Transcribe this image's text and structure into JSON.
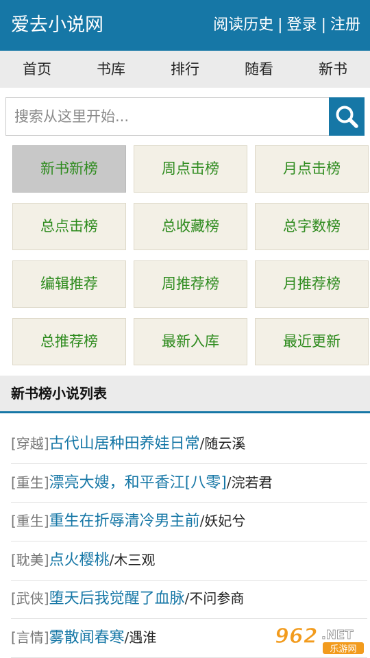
{
  "header": {
    "title": "爱去小说网",
    "links": [
      "阅读历史",
      "登录",
      "注册"
    ],
    "separator": "|"
  },
  "nav": {
    "items": [
      "首页",
      "书库",
      "排行",
      "随看",
      "新书"
    ]
  },
  "search": {
    "placeholder": "搜索从这里开始...",
    "icon": "search-icon"
  },
  "rankings": {
    "items": [
      {
        "label": "新书新榜",
        "active": true
      },
      {
        "label": "周点击榜",
        "active": false
      },
      {
        "label": "月点击榜",
        "active": false
      },
      {
        "label": "总点击榜",
        "active": false
      },
      {
        "label": "总收藏榜",
        "active": false
      },
      {
        "label": "总字数榜",
        "active": false
      },
      {
        "label": "编辑推荐",
        "active": false
      },
      {
        "label": "周推荐榜",
        "active": false
      },
      {
        "label": "月推荐榜",
        "active": false
      },
      {
        "label": "总推荐榜",
        "active": false
      },
      {
        "label": "最新入库",
        "active": false
      },
      {
        "label": "最近更新",
        "active": false
      }
    ]
  },
  "list": {
    "title": "新书榜小说列表",
    "slash": "/",
    "books": [
      {
        "genre": "[穿越]",
        "title": "古代山居种田养娃日常",
        "author": "随云溪"
      },
      {
        "genre": "[重生]",
        "title": "漂亮大嫂，和平香江[八零]",
        "author": "浣若君"
      },
      {
        "genre": "[重生]",
        "title": "重生在折辱清冷男主前",
        "author": "妖妃兮"
      },
      {
        "genre": "[耽美]",
        "title": "点火樱桃",
        "author": "木三观"
      },
      {
        "genre": "[武侠]",
        "title": "堕天后我觉醒了血脉",
        "author": "不问参商"
      },
      {
        "genre": "[言情]",
        "title": "雾散闻春寒",
        "author": "遇淮"
      }
    ]
  },
  "watermark": {
    "number": "962",
    "suffix": ".NET",
    "subtitle": "乐游网"
  },
  "colors": {
    "primary": "#1677a6",
    "rank_text": "#2e8b1e",
    "rank_bg": "#f3f0e6",
    "rank_active_bg": "#c8c8c8"
  }
}
